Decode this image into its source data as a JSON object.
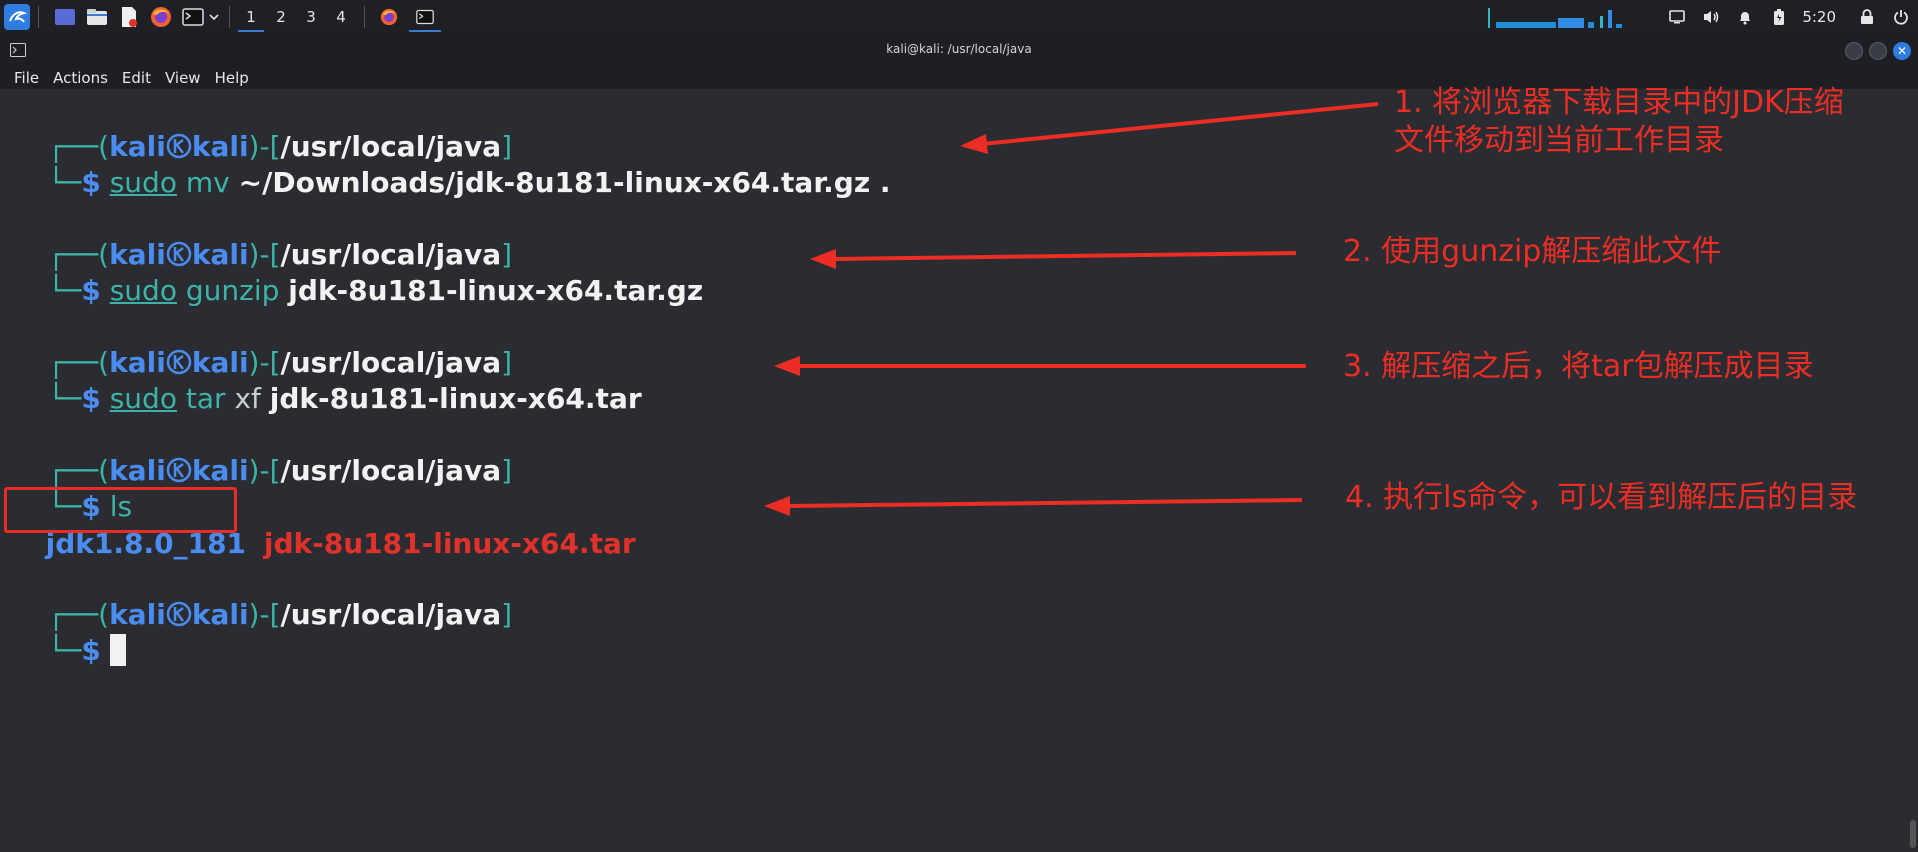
{
  "panel": {
    "workspaces": [
      "1",
      "2",
      "3",
      "4"
    ],
    "active_workspace": 0,
    "clock": "5:20",
    "icons": [
      "kali-menu-icon",
      "desktop-icon",
      "file-manager-icon",
      "text-editor-icon",
      "firefox-icon",
      "terminal-icon",
      "chevron-down-icon"
    ],
    "tray_icons": [
      "display-icon",
      "volume-icon",
      "notification-bell-icon",
      "battery-icon",
      "lock-icon",
      "power-icon"
    ]
  },
  "window": {
    "title": "kali@kali: /usr/local/java"
  },
  "menu": {
    "items": [
      "File",
      "Actions",
      "Edit",
      "View",
      "Help"
    ]
  },
  "terminal": {
    "prompt": {
      "user": "kali",
      "host": "kali",
      "path": "/usr/local/java",
      "open": "┌──(",
      "close": ")-[",
      "end": "]",
      "second": "└─",
      "dollar": "$"
    },
    "commands": [
      {
        "sudo": "sudo",
        "tool": "mv",
        "args": "~/Downloads/jdk-8u181-linux-x64.tar.gz ."
      },
      {
        "sudo": "sudo",
        "tool": "gunzip",
        "args": "jdk-8u181-linux-x64.tar.gz"
      },
      {
        "sudo": "sudo",
        "tool": "tar",
        "flag": "xf",
        "args": "jdk-8u181-linux-x64.tar"
      },
      {
        "tool": "ls"
      }
    ],
    "ls_output": {
      "dir": "jdk1.8.0_181",
      "file": "jdk-8u181-linux-x64.tar"
    }
  },
  "annotations": [
    {
      "text": "1. 将浏览器下载目录中的JDK压缩\n文件移动到当前工作目录"
    },
    {
      "text": "2. 使用gunzip解压缩此文件"
    },
    {
      "text": "3. 解压缩之后，将tar包解压成目录"
    },
    {
      "text": "4. 执行ls命令，可以看到解压后的目录"
    }
  ],
  "colors": {
    "annotation_red": "#ec2d24",
    "prompt_teal": "#3db3a8",
    "prompt_blue": "#4b8cf0",
    "terminal_bg": "#2a2c31"
  }
}
